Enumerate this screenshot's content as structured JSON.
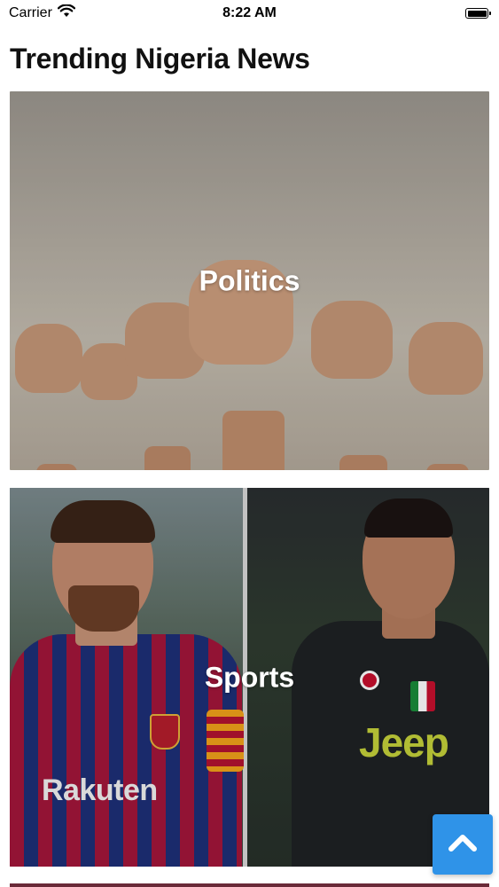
{
  "status_bar": {
    "carrier": "Carrier",
    "time": "8:22 AM",
    "icons": [
      "wifi-icon",
      "battery-icon"
    ]
  },
  "header": {
    "title": "Trending Nigeria News"
  },
  "categories": [
    {
      "label": "Politics",
      "image": "raised-fists-photo"
    },
    {
      "label": "Sports",
      "image": "footballers-photo"
    }
  ],
  "jersey_text": {
    "left": "Rakuten",
    "right": "Jeep"
  },
  "scroll_top": {
    "icon": "chevron-up-icon",
    "color": "#2f93e8"
  }
}
